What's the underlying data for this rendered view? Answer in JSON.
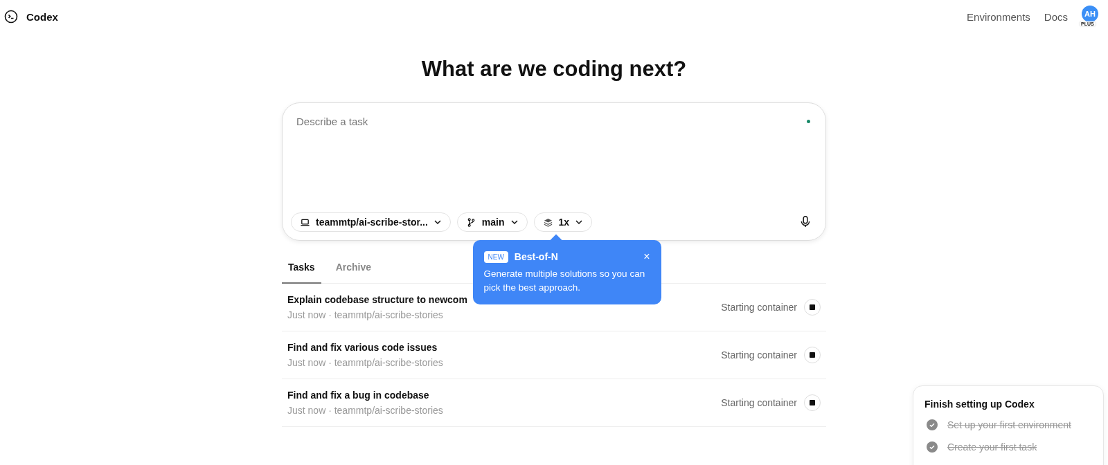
{
  "header": {
    "brand": "Codex",
    "nav": [
      "Environments",
      "Docs"
    ],
    "avatar": {
      "initials": "AH",
      "plan": "PLUS"
    }
  },
  "heading": "What are we coding next?",
  "composer": {
    "placeholder": "Describe a task",
    "chips": [
      {
        "kind": "repo",
        "label": "teammtp/ai-scribe-stor..."
      },
      {
        "kind": "branch",
        "label": "main"
      },
      {
        "kind": "versions",
        "label": "1x"
      }
    ]
  },
  "popover": {
    "badge": "NEW",
    "title": "Best-of-N",
    "text": "Generate multiple solutions so you can pick the best approach.",
    "close": "×"
  },
  "tabs": [
    {
      "label": "Tasks",
      "selected": true
    },
    {
      "label": "Archive",
      "selected": false
    }
  ],
  "tasks": [
    {
      "title": "Explain codebase structure to newcom",
      "meta": "Just now · teammtp/ai-scribe-stories",
      "status": "Starting container"
    },
    {
      "title": "Find and fix various code issues",
      "meta": "Just now · teammtp/ai-scribe-stories",
      "status": "Starting container"
    },
    {
      "title": "Find and fix a bug in codebase",
      "meta": "Just now · teammtp/ai-scribe-stories",
      "status": "Starting container"
    }
  ],
  "setup": {
    "title": "Finish setting up Codex",
    "items": [
      {
        "label": "Set up your first environment",
        "done": true
      },
      {
        "label": "Create your first task",
        "done": true
      }
    ]
  }
}
